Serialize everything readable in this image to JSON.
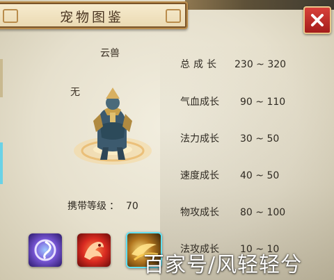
{
  "window": {
    "title": "宠物图鉴",
    "close_icon": "close-icon"
  },
  "pet": {
    "name": "云兽",
    "item_slot_text": "无",
    "carry_level_label": "携带等级",
    "carry_level_sep": "：",
    "carry_level_value": "70"
  },
  "stats": [
    {
      "label": "总成长",
      "value": "230 ~ 320"
    },
    {
      "label": "气血成长",
      "value": "90 ~ 110"
    },
    {
      "label": "法力成长",
      "value": "30 ~ 50"
    },
    {
      "label": "速度成长",
      "value": "40 ~ 50"
    },
    {
      "label": "物攻成长",
      "value": "80 ~ 100"
    },
    {
      "label": "法攻成长",
      "value": "10 ~ 10"
    }
  ],
  "skills": [
    {
      "icon": "swirl-skill-icon",
      "color": "#7a58d8"
    },
    {
      "icon": "phoenix-skill-icon",
      "color": "#d82a20"
    },
    {
      "icon": "golden-aura-skill-icon",
      "color": "#b0741e",
      "selected": true
    }
  ],
  "watermark": "百家号/风轻轻兮",
  "colors": {
    "close": "#c0302c",
    "frame": "#b98c4c",
    "selection": "#62e0f2"
  }
}
